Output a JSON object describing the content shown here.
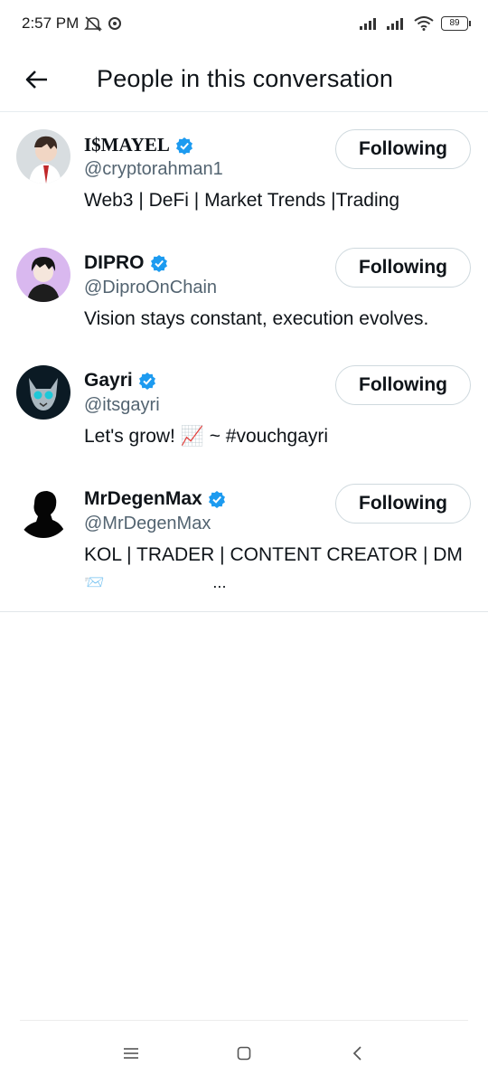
{
  "status_bar": {
    "time": "2:57 PM",
    "battery": "89",
    "icons": [
      "mute-icon",
      "chat-bubble-icon",
      "signal-icon",
      "signal-icon",
      "wifi-icon",
      "battery-icon"
    ]
  },
  "header": {
    "title": "People in this conversation",
    "back_icon": "arrow-left-icon"
  },
  "people": [
    {
      "name": "I$MAYEL",
      "handle": "@cryptorahman1",
      "bio": "Web3 | DeFi | Market Trends |Trading",
      "button": "Following",
      "verified": true
    },
    {
      "name": "DIPRO",
      "handle": "@DiproOnChain",
      "bio": "Vision stays constant, execution evolves.",
      "button": "Following",
      "verified": true
    },
    {
      "name": "Gayri",
      "handle": "@itsgayri",
      "bio": "Let's grow! 📈 ~ #vouchgayri",
      "button": "Following",
      "verified": true
    },
    {
      "name": "MrDegenMax",
      "handle": "@MrDegenMax",
      "bio": "KOL | TRADER | CONTENT CREATOR | DM",
      "bio_cont": "📨                        ...",
      "button": "Following",
      "verified": true
    }
  ],
  "colors": {
    "verified": "#1d9bf0",
    "secondary_text": "#536471",
    "border": "#cfd9de"
  },
  "nav_bar": {
    "icons": [
      "menu-icon",
      "home-square-icon",
      "back-chevron-icon"
    ]
  }
}
